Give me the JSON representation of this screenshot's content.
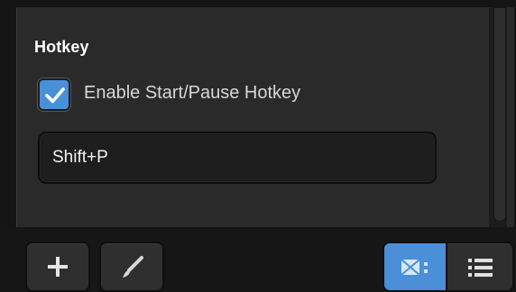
{
  "hotkey_section": {
    "title": "Hotkey",
    "enable_checkbox": {
      "label": "Enable Start/Pause Hotkey",
      "checked": true
    },
    "hotkey_value": "Shift+P"
  },
  "toolbar": {
    "add_icon": "plus-icon",
    "paint_icon": "brush-icon",
    "view_grid_icon": "tile-view-icon",
    "view_list_icon": "list-view-icon",
    "active_view": "grid"
  },
  "colors": {
    "accent": "#4a90d9",
    "panel": "#2a2a2a",
    "background": "#141414"
  }
}
